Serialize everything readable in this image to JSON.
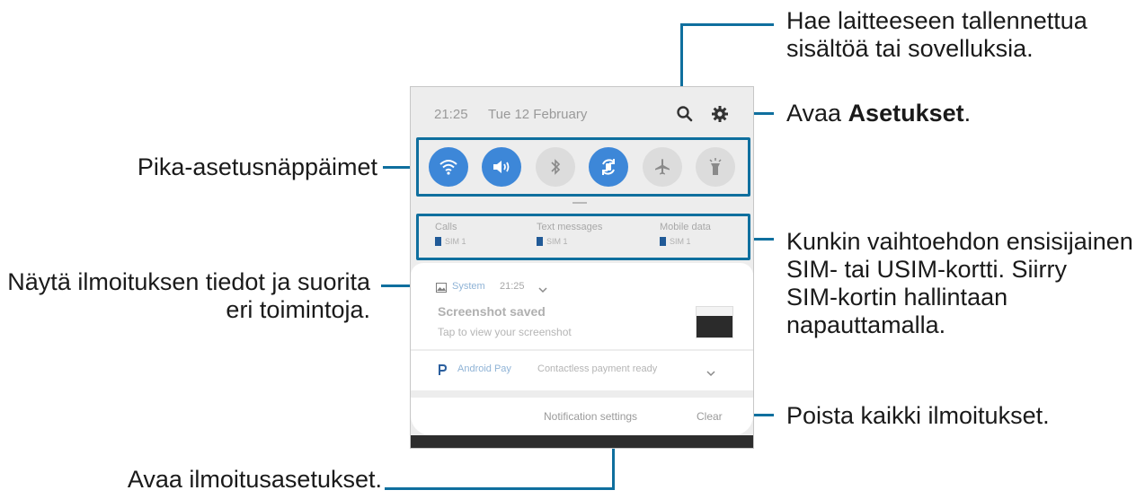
{
  "callouts": {
    "search_line1": "Hae laitteeseen tallennettua",
    "search_line2": "sisältöä tai sovelluksia.",
    "settings_prefix": "Avaa ",
    "settings_bold": "Asetukset",
    "settings_suffix": ".",
    "quick_settings": "Pika-asetusnäppäimet",
    "notif_line1": "Näytä ilmoituksen tiedot ja suorita",
    "notif_line2": "eri toimintoja.",
    "sim_line1": "Kunkin vaihtoehdon ensisijainen",
    "sim_line2": "SIM- tai USIM-kortti. Siirry",
    "sim_line3": "SIM-kortin hallintaan",
    "sim_line4": "napauttamalla.",
    "clear_all": "Poista kaikki ilmoitukset.",
    "notif_settings": "Avaa ilmoitusasetukset."
  },
  "panel": {
    "time": "21:25",
    "date": "Tue 12 February",
    "icons": [
      "search-icon",
      "gear-icon"
    ],
    "quick_buttons": [
      {
        "name": "wifi-icon",
        "state": "on"
      },
      {
        "name": "sound-icon",
        "state": "on"
      },
      {
        "name": "bluetooth-icon",
        "state": "off"
      },
      {
        "name": "auto-rotate-icon",
        "state": "on"
      },
      {
        "name": "airplane-icon",
        "state": "off"
      },
      {
        "name": "flashlight-icon",
        "state": "off"
      }
    ],
    "sim_options": [
      {
        "label": "Calls",
        "sim": "SIM 1"
      },
      {
        "label": "Text messages",
        "sim": "SIM 1"
      },
      {
        "label": "Mobile data",
        "sim": "SIM 1"
      }
    ],
    "notification": {
      "app": "System",
      "time": "21:25",
      "title": "Screenshot saved",
      "text": "Tap to view your screenshot"
    },
    "notification2": {
      "app": "Android Pay",
      "text": "Contactless payment ready"
    },
    "notification_settings": "Notification settings",
    "clear": "Clear"
  },
  "colors": {
    "callout_line": "#0f6f9e",
    "toggle_on": "#3d87d8",
    "toggle_off": "#dcdcdc"
  }
}
